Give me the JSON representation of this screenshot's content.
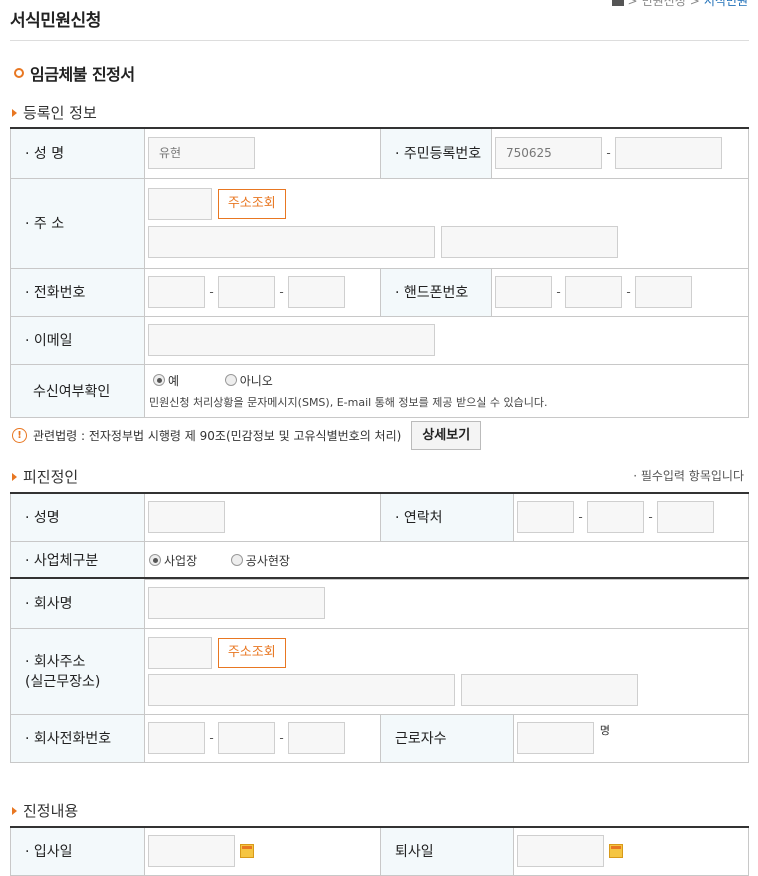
{
  "page": {
    "title": "서식민원신청",
    "breadcrumb": [
      "민원신청",
      "서식민원"
    ]
  },
  "form": {
    "title": "임금체불 진정서"
  },
  "sections": {
    "registrant": "등록인 정보",
    "respondent": "피진정인",
    "content": "진정내용"
  },
  "registrant": {
    "name_label": "· 성 명",
    "name_value": "유현",
    "rrn_label": "· 주민등록번호",
    "rrn_first": "750625",
    "address_label": "· 주 소",
    "address_btn": "주소조회",
    "phone_label": "· 전화번호",
    "mobile_label": "· 핸드폰번호",
    "email_label": "· 이메일",
    "receive_label": "수신여부확인",
    "receive_yes": "예",
    "receive_no": "아니오",
    "receive_note": "민원신청 처리상황을 문자메시지(SMS), E-mail 통해 정보를 제공 받으실 수 있습니다."
  },
  "notice": {
    "text": "관련법령 : 전자정부법 시행령 제 90조(민감정보 및 고유식별번호의 처리)",
    "button": "상세보기"
  },
  "required_note": "· 필수입력 항목입니다",
  "respondent": {
    "name_label": "· 성명",
    "contact_label": "· 연락처",
    "biz_type_label": "· 사업체구분",
    "biz_type_site": "사업장",
    "biz_type_construction": "공사현장",
    "company_label": "· 회사명",
    "company_addr_label_1": "· 회사주소",
    "company_addr_label_2": "(실근무장소)",
    "address_btn": "주소조회",
    "company_phone_label": "· 회사전화번호",
    "workers_label": "근로자수",
    "workers_unit": "명"
  },
  "content": {
    "join_label": "· 입사일",
    "leave_label": "퇴사일"
  },
  "colors": {
    "accent": "#e87722",
    "label_bg": "#f3f9fb",
    "input_bg": "#f7f7f7"
  }
}
